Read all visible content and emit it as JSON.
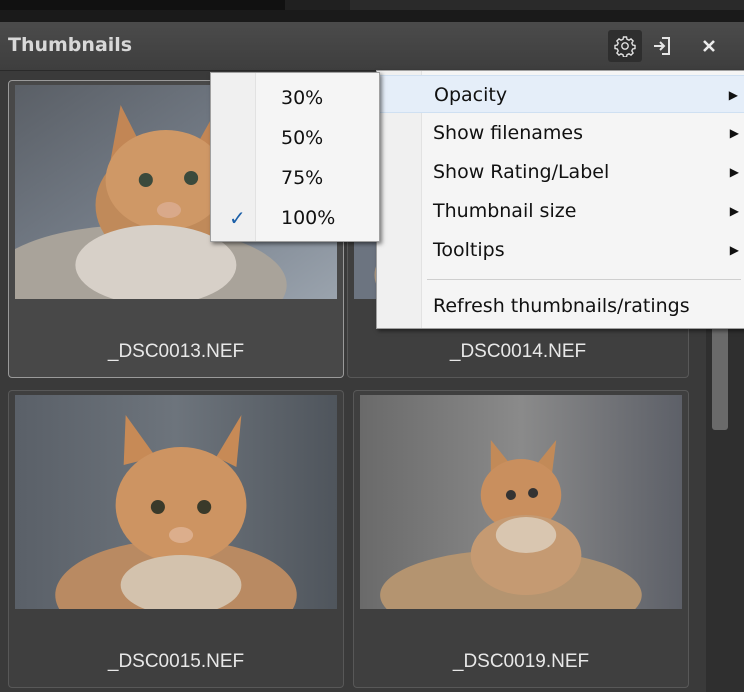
{
  "panel": {
    "title": "Thumbnails"
  },
  "thumbnails": [
    {
      "filename": "_DSC0013.NEF",
      "selected": true
    },
    {
      "filename": "_DSC0014.NEF",
      "selected": false
    },
    {
      "filename": "_DSC0015.NEF",
      "selected": false
    },
    {
      "filename": "_DSC0019.NEF",
      "selected": false
    }
  ],
  "main_menu": {
    "items": [
      {
        "label": "Opacity",
        "has_submenu": true,
        "highlighted": true
      },
      {
        "label": "Show filenames",
        "has_submenu": true
      },
      {
        "label": "Show Rating/Label",
        "has_submenu": true
      },
      {
        "label": "Thumbnail size",
        "has_submenu": true
      },
      {
        "label": "Tooltips",
        "has_submenu": true
      },
      {
        "label": "Refresh thumbnails/ratings",
        "has_submenu": false
      }
    ],
    "arrow_glyph": "▶"
  },
  "opacity_menu": {
    "items": [
      {
        "label": "30%",
        "checked": false
      },
      {
        "label": "50%",
        "checked": false
      },
      {
        "label": "75%",
        "checked": false
      },
      {
        "label": "100%",
        "checked": true
      }
    ],
    "check_glyph": "✓"
  },
  "colors": {
    "panel_bg": "#3a3a3a",
    "menu_bg": "#f5f5f5",
    "menu_highlight": "#e5eef9",
    "check_color": "#1b5fa8"
  },
  "icons": [
    "gear-icon",
    "detach-icon",
    "close-icon"
  ]
}
